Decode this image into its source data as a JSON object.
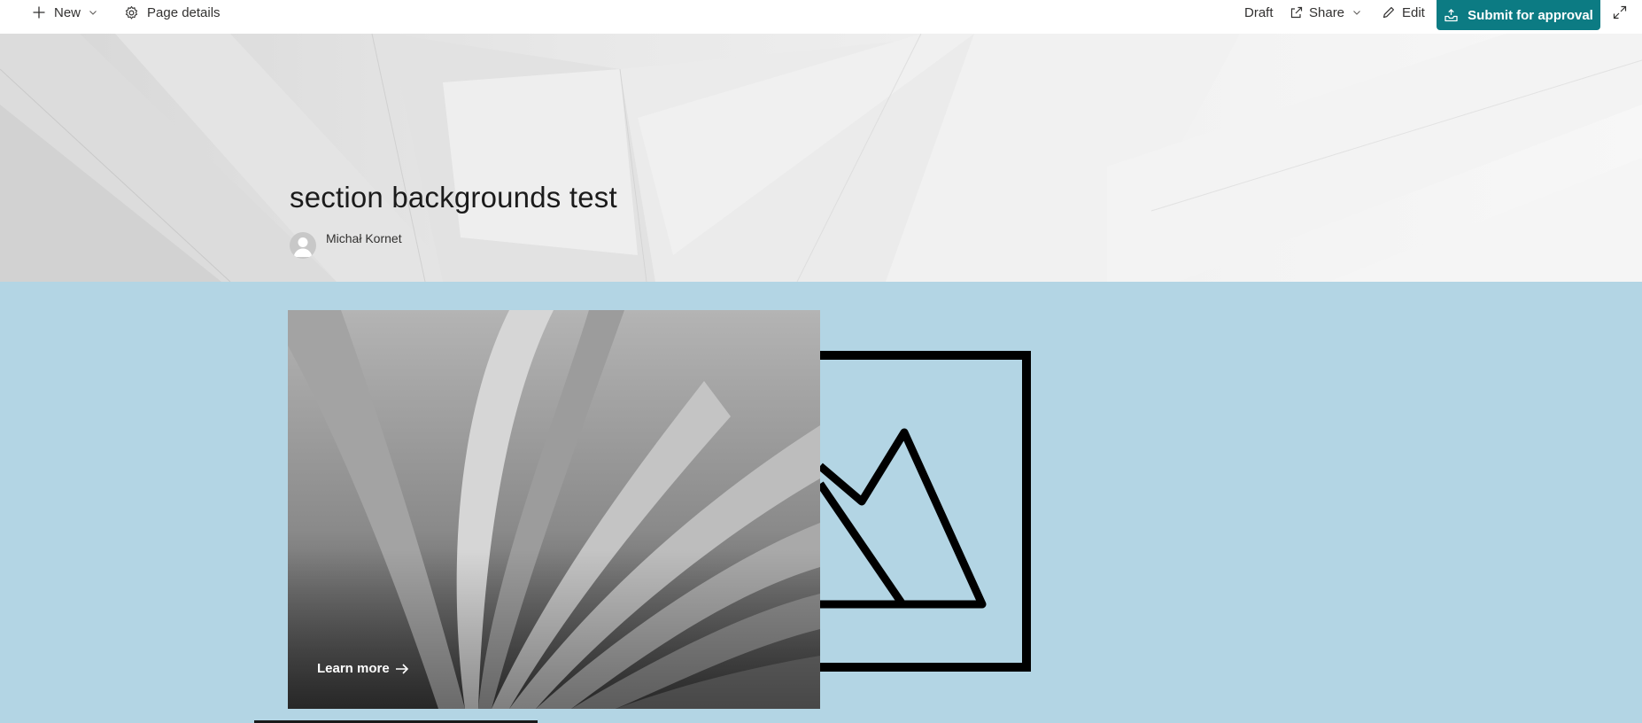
{
  "command_bar": {
    "new_label": "New",
    "page_details_label": "Page details",
    "status_label": "Draft",
    "share_label": "Share",
    "edit_label": "Edit",
    "submit_label": "Submit for approval",
    "icons": [
      "plus-icon",
      "chevron-down-icon",
      "gear-icon",
      "share-icon",
      "pencil-icon",
      "inbox-upload-icon",
      "expand-icon"
    ]
  },
  "header": {
    "title": "section backgrounds test",
    "author": "Michał Kornet"
  },
  "section": {
    "background_color": "#b3d5e4",
    "hero": {
      "link_label": "Learn more"
    }
  },
  "colors": {
    "accent": "#0c7b83"
  }
}
